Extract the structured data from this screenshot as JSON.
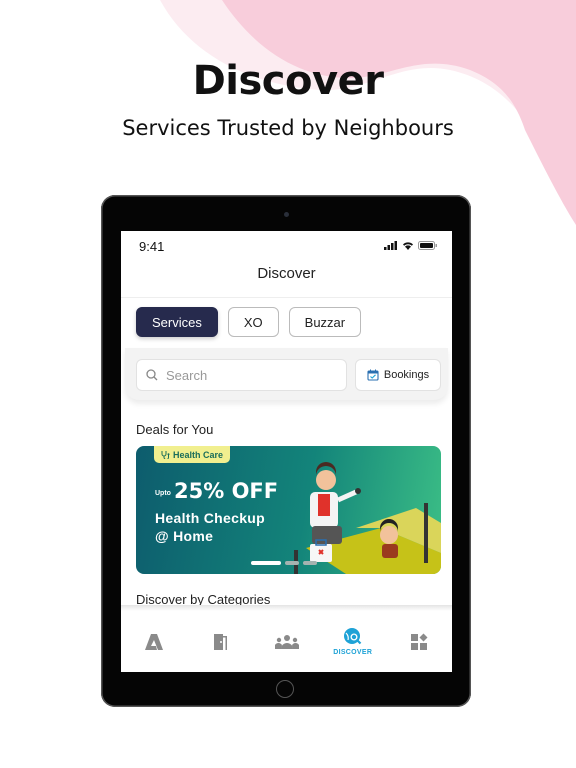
{
  "hero": {
    "title": "Discover",
    "subtitle": "Services Trusted by Neighbours",
    "accent_color": "#f8cddb"
  },
  "status_bar": {
    "time": "9:41",
    "icons": [
      "signal-icon",
      "wifi-icon",
      "battery-icon"
    ]
  },
  "nav": {
    "title": "Discover"
  },
  "segments": {
    "items": [
      {
        "label": "Services",
        "active": true
      },
      {
        "label": "XO",
        "active": false
      },
      {
        "label": "Buzzar",
        "active": false
      }
    ],
    "active_color": "#262a4d"
  },
  "search": {
    "placeholder": "Search",
    "value": ""
  },
  "bookings": {
    "label": "Bookings",
    "icon": "calendar-check-icon"
  },
  "deals": {
    "title": "Deals for You",
    "banner": {
      "badge": "Health Care",
      "upto": "Upto",
      "discount": "25% OFF",
      "line1": "Health Checkup",
      "line2": "@ Home",
      "slides": 3,
      "active_slide": 1
    }
  },
  "categories": {
    "title": "Discover by Categories"
  },
  "tabbar": {
    "items": [
      {
        "icon": "app-logo-icon",
        "label": "",
        "active": false
      },
      {
        "icon": "door-icon",
        "label": "",
        "active": false
      },
      {
        "icon": "community-icon",
        "label": "",
        "active": false
      },
      {
        "icon": "discover-icon",
        "label": "DISCOVER",
        "active": true
      },
      {
        "icon": "more-apps-icon",
        "label": "",
        "active": false
      }
    ],
    "active_color": "#1ea2d6",
    "inactive_color": "#8a8a8a"
  }
}
